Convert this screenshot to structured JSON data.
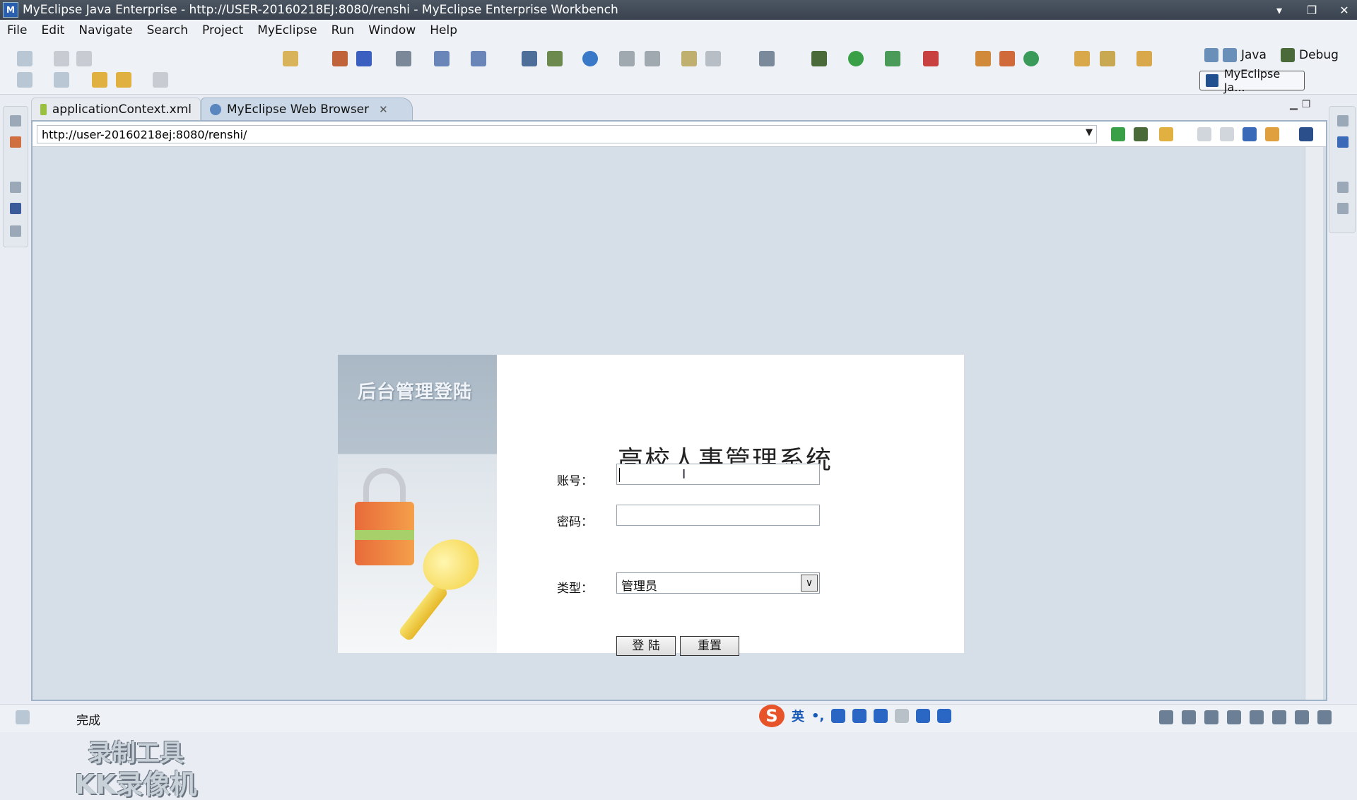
{
  "window": {
    "title": "MyEclipse Java Enterprise - http://USER-20160218EJ:8080/renshi - MyEclipse Enterprise Workbench",
    "controls": [
      "▾",
      "❐",
      "✕"
    ]
  },
  "menu": [
    "File",
    "Edit",
    "Navigate",
    "Search",
    "Project",
    "MyEclipse",
    "Run",
    "Window",
    "Help"
  ],
  "perspectives": {
    "java": "Java",
    "debug": "Debug",
    "active": "MyEclipse Ja..."
  },
  "tabs": [
    {
      "label": "applicationContext.xml",
      "icon": "xml-file-icon",
      "active": false
    },
    {
      "label": "MyEclipse Web Browser",
      "icon": "globe-icon",
      "active": true,
      "close": "✕"
    }
  ],
  "browser": {
    "url": "http://user-20160218ej:8080/renshi/",
    "dropdown": "▼"
  },
  "login": {
    "banner": "后台管理登陆",
    "system_title": "高校人事管理系统",
    "account_label": "账号：",
    "password_label": "密码：",
    "type_label": "类型：",
    "type_selected": "管理员",
    "login_button": "登 陆",
    "reset_button": "重置"
  },
  "watermark": {
    "line1": "录制工具",
    "line2": "KK录像机"
  },
  "status": {
    "text": "完成"
  },
  "ime": {
    "logo": "S",
    "mode": "英",
    "punct": "•,"
  },
  "colors": {
    "title_bar": "#3f4854",
    "tab_active": "#c9d7e6",
    "page_bg": "#d6dfe7",
    "ime_brand": "#e8542a"
  }
}
